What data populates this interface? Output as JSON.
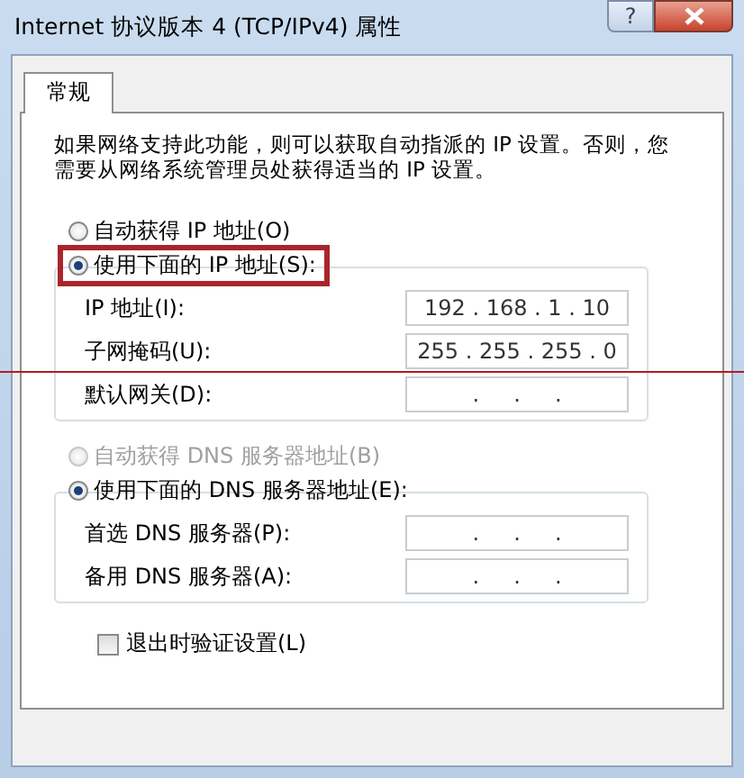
{
  "window": {
    "title": "Internet 协议版本 4 (TCP/IPv4) 属性",
    "help_glyph": "?"
  },
  "tabs": [
    {
      "label": "常规",
      "selected": true
    }
  ],
  "description": "如果网络支持此功能，则可以获取自动指派的 IP 设置。否则，您需要从网络系统管理员处获得适当的 IP 设置。",
  "ip_section": {
    "radios": [
      {
        "label": "自动获得 IP 地址(O)",
        "selected": false,
        "disabled": false,
        "highlighted": false
      },
      {
        "label": "使用下面的 IP 地址(S):",
        "selected": true,
        "disabled": false,
        "highlighted": true
      }
    ],
    "fields": [
      {
        "label": "IP 地址(I):",
        "value": "192 . 168 . 1 . 10",
        "disabled": false
      },
      {
        "label": "子网掩码(U):",
        "value": "255 . 255 . 255 . 0",
        "disabled": false
      },
      {
        "label": "默认网关(D):",
        "value": ".     .     .",
        "disabled": false
      }
    ]
  },
  "dns_section": {
    "radios": [
      {
        "label": "自动获得 DNS 服务器地址(B)",
        "selected": false,
        "disabled": true,
        "highlighted": false
      },
      {
        "label": "使用下面的 DNS 服务器地址(E):",
        "selected": true,
        "disabled": false,
        "highlighted": false
      }
    ],
    "fields": [
      {
        "label": "首选 DNS 服务器(P):",
        "value": ".     .     .",
        "disabled": false
      },
      {
        "label": "备用 DNS 服务器(A):",
        "value": ".     .     .",
        "disabled": false
      }
    ]
  },
  "validate_checkbox": {
    "label": "退出时验证设置(L)",
    "checked": false
  },
  "annotation_line": true
}
